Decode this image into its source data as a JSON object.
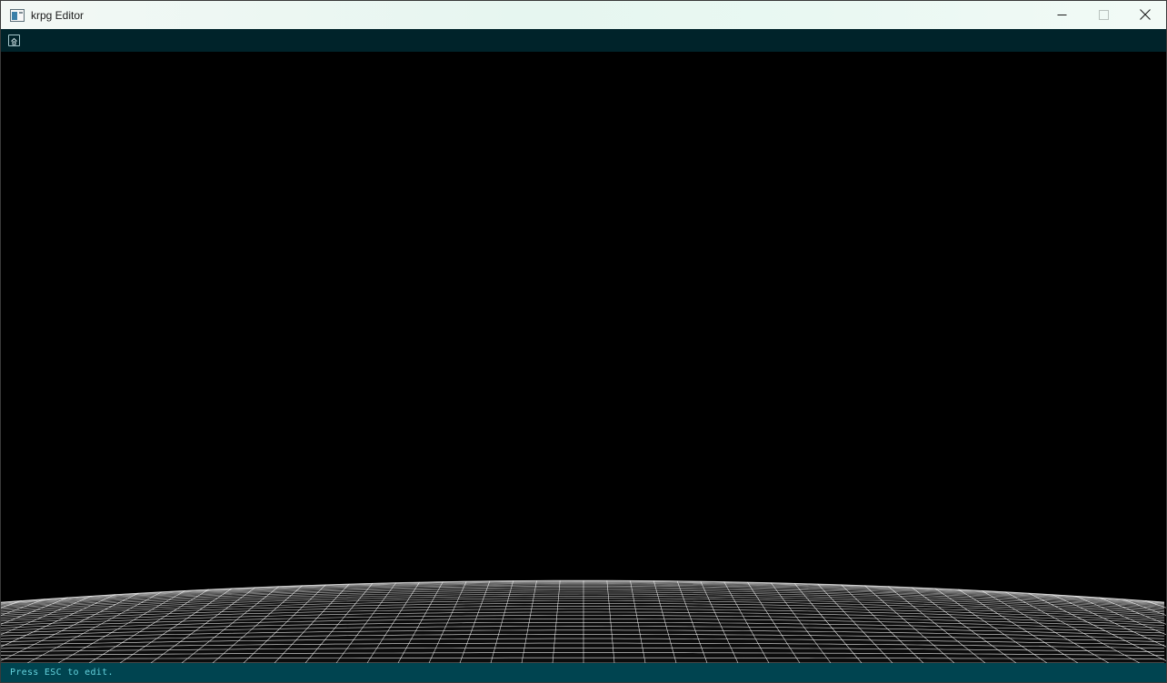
{
  "window": {
    "title": "krpg Editor",
    "icons": {
      "app": "app-window-icon",
      "minimize": "minimize-icon",
      "maximize": "maximize-icon",
      "close": "close-icon"
    }
  },
  "toolbar": {
    "home_icon": "home-icon"
  },
  "viewport": {
    "scene": "perspective-grid-floor",
    "grid_color": "#ffffff",
    "background_color": "#000000"
  },
  "statusbar": {
    "message": "Press ESC to edit."
  },
  "colors": {
    "toolbar_bg": "#00232a",
    "statusbar_bg": "#004450",
    "status_text": "#63d1dc"
  }
}
